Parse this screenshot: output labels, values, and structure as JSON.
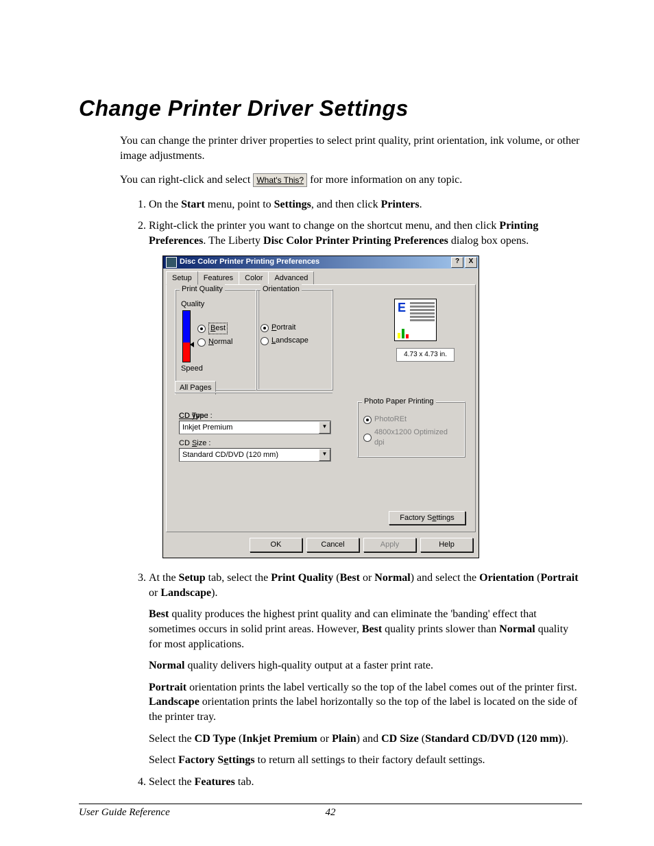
{
  "title": "Change Printer Driver Settings",
  "intro1": "You can change the printer driver properties to select print quality, print orientation, ink volume, or other image adjustments.",
  "intro2a": "You can right-click and select ",
  "whats_this": "What's This?",
  "intro2b": " for more information on any topic.",
  "step1_a": "On the ",
  "step1_b": "Start",
  "step1_c": " menu, point to ",
  "step1_d": "Settings",
  "step1_e": ", and then click ",
  "step1_f": "Printers",
  "step1_g": ".",
  "step2_a": "Right-click the printer you want to change on the shortcut menu, and then click ",
  "step2_b": "Printing Preferences",
  "step2_c": ".  The Liberty ",
  "step2_d": "Disc Color Printer Printing Preferences",
  "step2_e": " dialog box opens.",
  "dialog": {
    "title": "Disc Color Printer Printing Preferences",
    "help_btn": "?",
    "close_btn": "X",
    "tabs": {
      "setup": "Setup",
      "features": "Features",
      "color": "Color",
      "advanced": "Advanced"
    },
    "print_quality_legend": "Print Quality",
    "quality_label": "Quality",
    "speed_label": "Speed",
    "quality_best": "Best",
    "quality_normal": "Normal",
    "orientation_legend": "Orientation",
    "orient_portrait": "Portrait",
    "orient_landscape": "Landscape",
    "all_pages": "All Pages",
    "size_readout": "4.73 x 4.73 in.",
    "cd_type_label": "CD Type :",
    "cd_type_value": "Inkjet Premium",
    "cd_size_label": "CD Size :",
    "cd_size_value": "Standard CD/DVD (120 mm)",
    "photo_legend": "Photo Paper Printing",
    "photo_ret": "PhotoREt",
    "photo_dpi": "4800x1200 Optimized dpi",
    "factory_settings": "Factory Settings",
    "ok": "OK",
    "cancel": "Cancel",
    "apply": "Apply",
    "help": "Help"
  },
  "step3_a": "At the ",
  "step3_b": "Setup",
  "step3_c": " tab, select the ",
  "step3_d": "Print Quality",
  "step3_e": " (",
  "step3_f": "Best",
  "step3_g": " or ",
  "step3_h": "Normal",
  "step3_i": ") and select the ",
  "step3_j": "Orientation",
  "step3_k": " (",
  "step3_l": "Portrait",
  "step3_m": " or ",
  "step3_n": "Landscape",
  "step3_o": ").",
  "p_best_a": "Best",
  "p_best_b": " quality produces the highest print quality and can eliminate the 'banding' effect that sometimes occurs in solid print areas. However, ",
  "p_best_c": "Best",
  "p_best_d": " quality prints slower than ",
  "p_best_e": "Normal",
  "p_best_f": " quality for most applications.",
  "p_normal_a": "Normal",
  "p_normal_b": " quality delivers high-quality output at a faster print rate.",
  "p_port_a": "Portrait",
  "p_port_b": " orientation prints the label vertically so the top of the label comes out of the printer first. ",
  "p_port_c": "Landscape",
  "p_port_d": " orientation prints the label horizontally so the top of the label is located on the side of the printer tray.",
  "p_sel1_a": "Select the ",
  "p_sel1_b": "CD Type",
  "p_sel1_c": " (",
  "p_sel1_d": "Inkjet Premium",
  "p_sel1_e": " or ",
  "p_sel1_f": "Plain",
  "p_sel1_g": ") and ",
  "p_sel1_h": "CD Size",
  "p_sel1_i": " (",
  "p_sel1_j": "Standard CD/DVD (120 mm)",
  "p_sel1_k": ").",
  "p_sel2_a": "Select ",
  "p_sel2_b": "Factory Settings",
  "p_sel2_c": " to return all settings to their factory default settings.",
  "step4_a": "Select the ",
  "step4_b": "Features",
  "step4_c": " tab.",
  "footer": {
    "name": "User Guide Reference",
    "page": "42"
  }
}
